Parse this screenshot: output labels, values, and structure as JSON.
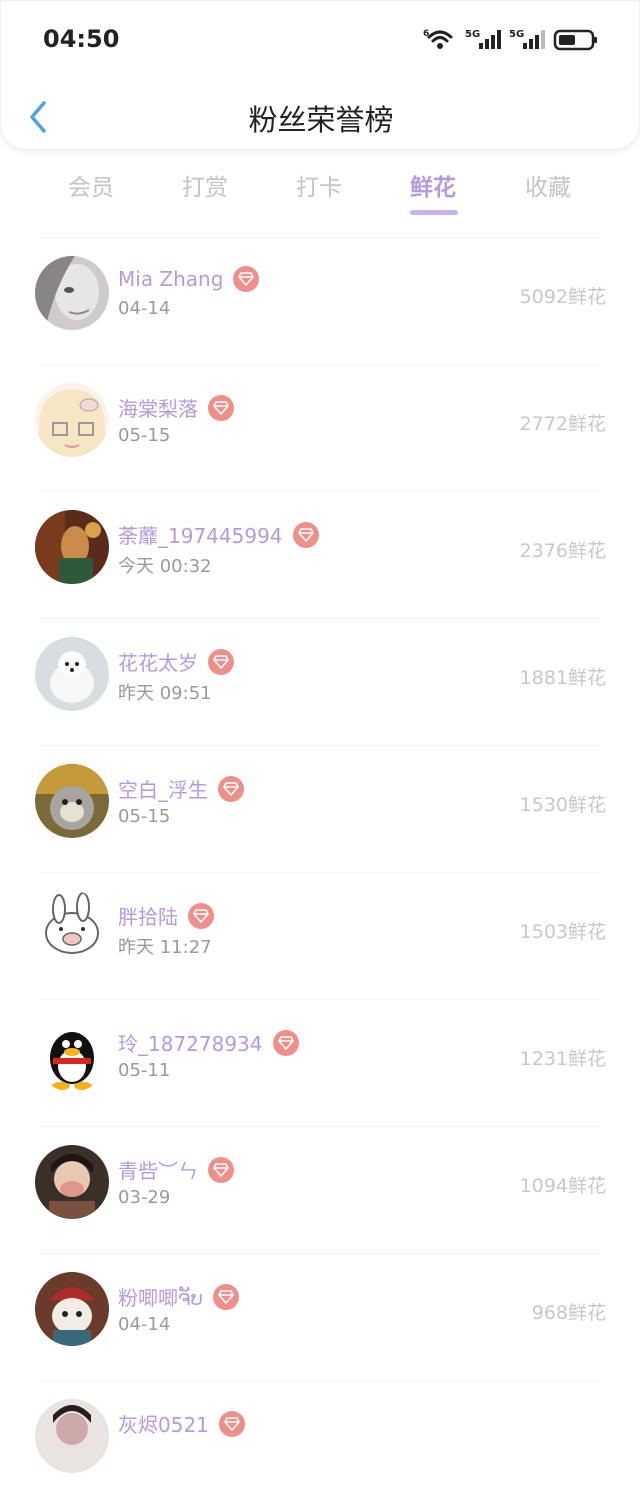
{
  "status_bar": {
    "time": "04:50",
    "wifi_label": "6",
    "sim1_label": "5G",
    "sim2_label": "5G"
  },
  "header": {
    "title": "粉丝荣誉榜"
  },
  "tabs": [
    {
      "label": "会员"
    },
    {
      "label": "打赏"
    },
    {
      "label": "打卡"
    },
    {
      "label": "鲜花",
      "active": true
    },
    {
      "label": "收藏"
    }
  ],
  "colors": {
    "accent": "#b69ae0",
    "badge": "#ee8f8c",
    "muted": "#c8c8c8"
  },
  "fans": [
    {
      "name": "Mia Zhang",
      "date": "04-14",
      "count": "5092鲜花"
    },
    {
      "name": "海棠梨落",
      "date": "05-15",
      "count": "2772鲜花"
    },
    {
      "name": "荼蘼_197445994",
      "date": "今天 00:32",
      "count": "2376鲜花"
    },
    {
      "name": "花花太岁",
      "date": "昨天 09:51",
      "count": "1881鲜花"
    },
    {
      "name": "空白_浮生",
      "date": "05-15",
      "count": "1530鲜花"
    },
    {
      "name": "胖拾陆",
      "date": "昨天 11:27",
      "count": "1503鲜花"
    },
    {
      "name": "玲_187278934",
      "date": "05-11",
      "count": "1231鲜花"
    },
    {
      "name": "青呰︶ㄣ",
      "date": "03-29",
      "count": "1094鲜花"
    },
    {
      "name": "粉唧唧ຈັບ",
      "date": "04-14",
      "count": "968鲜花"
    },
    {
      "name": "灰烬0521",
      "date": "",
      "count": ""
    }
  ]
}
